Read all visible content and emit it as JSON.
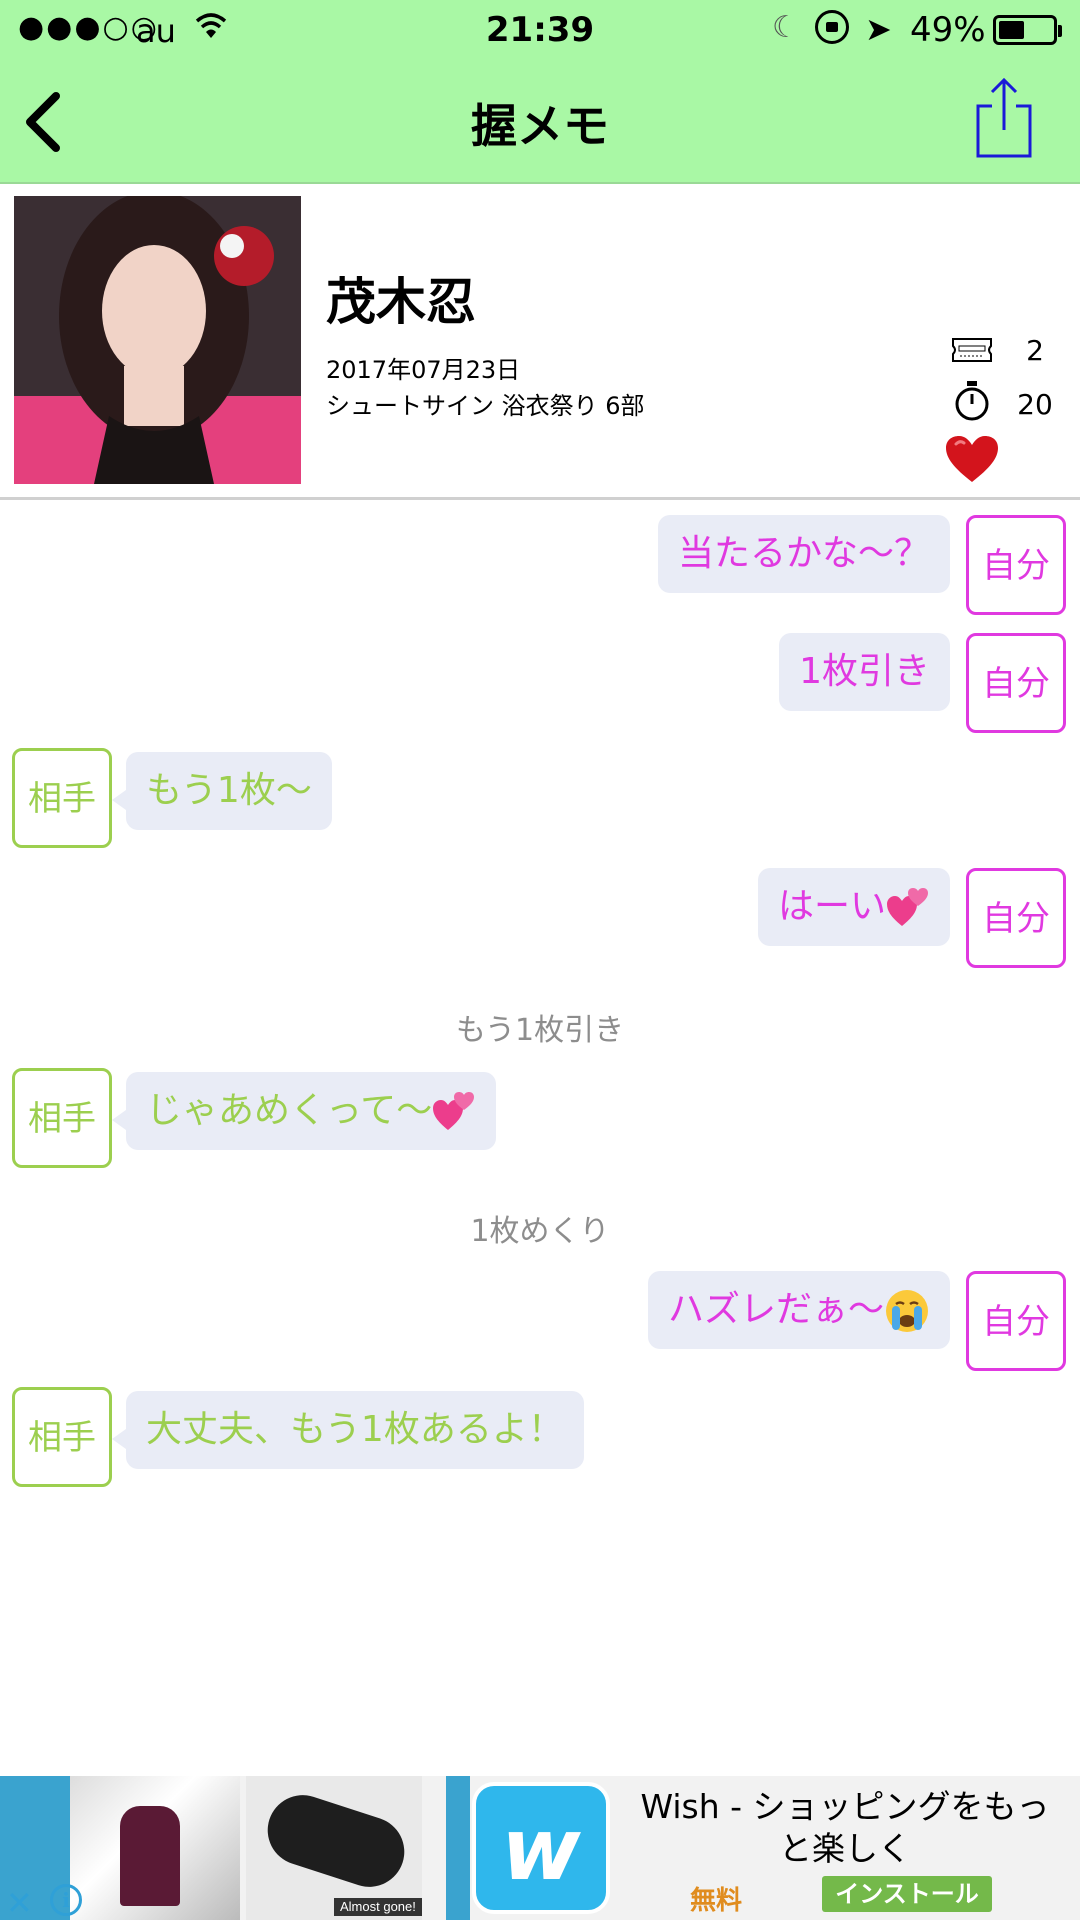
{
  "status_bar": {
    "signal": "●●●○○",
    "carrier": "au",
    "time": "21:39",
    "battery_percent": "49%",
    "battery_level": 0.49,
    "icons": [
      "wifi-icon",
      "moon-icon",
      "rotation-lock-icon",
      "location-arrow-icon",
      "battery-icon"
    ]
  },
  "nav": {
    "title": "握メモ",
    "back_icon": "chevron-left-icon",
    "share_icon": "share-icon"
  },
  "profile": {
    "name": "茂木忍",
    "date": "2017年07月23日",
    "event": "シュートサイン 浴衣祭り 6部",
    "tickets": "2",
    "seconds": "20",
    "favorite": true
  },
  "chat": {
    "items": [
      {
        "kind": "message",
        "sender": "self",
        "tag": "自分",
        "text": "当たるかな〜？"
      },
      {
        "kind": "message",
        "sender": "self",
        "tag": "自分",
        "text": "1枚引き"
      },
      {
        "kind": "message",
        "sender": "other",
        "tag": "相手",
        "text": "もう1枚〜"
      },
      {
        "kind": "message",
        "sender": "self",
        "tag": "自分",
        "text": "はーい",
        "emoji": "two-hearts-emoji"
      },
      {
        "kind": "system",
        "text": "もう1枚引き"
      },
      {
        "kind": "message",
        "sender": "other",
        "tag": "相手",
        "text": "じゃあめくって〜",
        "emoji": "two-hearts-emoji"
      },
      {
        "kind": "system",
        "text": "1枚めくり"
      },
      {
        "kind": "message",
        "sender": "self",
        "tag": "自分",
        "text": "ハズレだぁ〜",
        "emoji": "crying-face-emoji"
      },
      {
        "kind": "message",
        "sender": "other",
        "tag": "相手",
        "text": "大丈夫、もう1枚あるよ！"
      }
    ]
  },
  "ad": {
    "thumb_label": "Almost gone!",
    "title": "Wish - ショッピングをもっと楽しく",
    "price": "無料",
    "install_label": "インストール",
    "app_logo_letter": "w",
    "close_glyph": "✕",
    "info_glyph": "i"
  },
  "colors": {
    "header_bg": "#a9f8a5",
    "self_color": "#e039e0",
    "other_color": "#9ccf4f",
    "bubble_bg": "#e9ecf6",
    "share_icon": "#1a1ad8",
    "heart": "#d3141c"
  }
}
